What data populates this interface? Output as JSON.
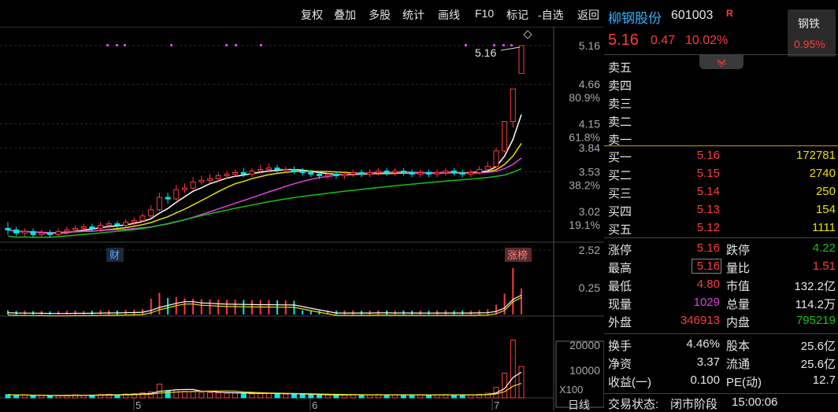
{
  "toolbar": {
    "items": [
      "复权",
      "叠加",
      "多股",
      "统计",
      "画线",
      "F10",
      "标记",
      "-自选",
      "返回"
    ]
  },
  "stock": {
    "name": "柳钢股份",
    "code": "601003",
    "flag": "R",
    "price": "5.16",
    "change": "0.47",
    "change_pct": "10.02%",
    "sector": "钢铁",
    "sector_pct": "0.95%"
  },
  "sell_labels": [
    "卖五",
    "卖四",
    "卖三",
    "卖二",
    "卖一"
  ],
  "buy": [
    {
      "label": "买一",
      "price": "5.16",
      "vol": "172781"
    },
    {
      "label": "买二",
      "price": "5.15",
      "vol": "2740"
    },
    {
      "label": "买三",
      "price": "5.14",
      "vol": "250"
    },
    {
      "label": "买四",
      "price": "5.13",
      "vol": "154"
    },
    {
      "label": "买五",
      "price": "5.12",
      "vol": "1111"
    }
  ],
  "stats1": [
    {
      "l1": "涨停",
      "v1": "5.16",
      "l2": "跌停",
      "v2": "4.22"
    },
    {
      "l1": "最高",
      "v1": "5.16",
      "l2": "量比",
      "v2": "1.51"
    },
    {
      "l1": "最低",
      "v1": "4.80",
      "l2": "市值",
      "v2": "132.2亿"
    },
    {
      "l1": "现量",
      "v1": "1029",
      "l2": "总量",
      "v2": "114.2万"
    },
    {
      "l1": "外盘",
      "v1": "346913",
      "l2": "内盘",
      "v2": "795219"
    }
  ],
  "stats2": [
    {
      "l1": "换手",
      "v1": "4.46%",
      "l2": "股本",
      "v2": "25.6亿"
    },
    {
      "l1": "净资",
      "v1": "3.37",
      "l2": "流通",
      "v2": "25.6亿"
    },
    {
      "l1": "收益(一)",
      "v1": "0.100",
      "l2": "PE(动)",
      "v2": "12.7"
    }
  ],
  "status": {
    "label": "交易状态:",
    "value": "闭市阶段",
    "time": "15:00:06"
  },
  "axis": {
    "price_ticks": [
      "5.16",
      "4.66",
      "4.15",
      "3.84",
      "3.53",
      "3.02",
      "2.52"
    ],
    "pct_ticks": [
      "80.9%",
      "61.8%",
      "38.2%",
      "19.1%"
    ],
    "macd_tick": "0.25",
    "vol_ticks": [
      "20000",
      "10000"
    ],
    "vol_unit": "X100",
    "x_ticks": [
      "5",
      "6",
      "7"
    ],
    "period": "日线"
  },
  "annotations": {
    "high_label": "5.16",
    "cai": "财",
    "zhangbang": "涨榜"
  },
  "chart_data": {
    "type": "candlestick",
    "ylim": [
      2.52,
      5.16
    ],
    "candles": [
      [
        2.8,
        2.78,
        2.88,
        2.72
      ],
      [
        2.78,
        2.74,
        2.82,
        2.7
      ],
      [
        2.74,
        2.76,
        2.8,
        2.7
      ],
      [
        2.76,
        2.72,
        2.8,
        2.68
      ],
      [
        2.72,
        2.74,
        2.78,
        2.68
      ],
      [
        2.74,
        2.72,
        2.78,
        2.68
      ],
      [
        2.72,
        2.76,
        2.8,
        2.7
      ],
      [
        2.76,
        2.78,
        2.82,
        2.72
      ],
      [
        2.78,
        2.8,
        2.84,
        2.74
      ],
      [
        2.8,
        2.82,
        2.86,
        2.76
      ],
      [
        2.82,
        2.8,
        2.86,
        2.76
      ],
      [
        2.8,
        2.84,
        2.88,
        2.78
      ],
      [
        2.84,
        2.86,
        2.9,
        2.8
      ],
      [
        2.86,
        2.84,
        2.9,
        2.8
      ],
      [
        2.84,
        2.88,
        2.92,
        2.82
      ],
      [
        2.88,
        2.9,
        2.94,
        2.84
      ],
      [
        2.9,
        2.96,
        3.0,
        2.88
      ],
      [
        2.96,
        3.04,
        3.1,
        2.94
      ],
      [
        3.04,
        3.2,
        3.26,
        3.02
      ],
      [
        3.2,
        3.18,
        3.26,
        3.12
      ],
      [
        3.18,
        3.3,
        3.36,
        3.16
      ],
      [
        3.3,
        3.32,
        3.38,
        3.26
      ],
      [
        3.32,
        3.4,
        3.46,
        3.3
      ],
      [
        3.4,
        3.42,
        3.48,
        3.36
      ],
      [
        3.42,
        3.44,
        3.5,
        3.38
      ],
      [
        3.44,
        3.48,
        3.52,
        3.4
      ],
      [
        3.48,
        3.5,
        3.54,
        3.44
      ],
      [
        3.5,
        3.52,
        3.56,
        3.46
      ],
      [
        3.52,
        3.5,
        3.58,
        3.46
      ],
      [
        3.5,
        3.54,
        3.58,
        3.46
      ],
      [
        3.54,
        3.56,
        3.62,
        3.5
      ],
      [
        3.56,
        3.58,
        3.64,
        3.52
      ],
      [
        3.58,
        3.56,
        3.62,
        3.52
      ],
      [
        3.56,
        3.56,
        3.6,
        3.52
      ],
      [
        3.56,
        3.54,
        3.6,
        3.5
      ],
      [
        3.54,
        3.52,
        3.58,
        3.48
      ],
      [
        3.52,
        3.5,
        3.56,
        3.46
      ],
      [
        3.5,
        3.48,
        3.54,
        3.44
      ],
      [
        3.48,
        3.5,
        3.54,
        3.44
      ],
      [
        3.5,
        3.48,
        3.54,
        3.44
      ],
      [
        3.48,
        3.5,
        3.54,
        3.44
      ],
      [
        3.5,
        3.52,
        3.56,
        3.46
      ],
      [
        3.52,
        3.5,
        3.56,
        3.46
      ],
      [
        3.5,
        3.52,
        3.56,
        3.46
      ],
      [
        3.52,
        3.54,
        3.58,
        3.48
      ],
      [
        3.54,
        3.52,
        3.58,
        3.48
      ],
      [
        3.52,
        3.54,
        3.58,
        3.48
      ],
      [
        3.54,
        3.52,
        3.58,
        3.48
      ],
      [
        3.52,
        3.5,
        3.56,
        3.46
      ],
      [
        3.5,
        3.52,
        3.56,
        3.46
      ],
      [
        3.52,
        3.5,
        3.56,
        3.46
      ],
      [
        3.5,
        3.52,
        3.56,
        3.46
      ],
      [
        3.52,
        3.54,
        3.58,
        3.48
      ],
      [
        3.54,
        3.52,
        3.58,
        3.48
      ],
      [
        3.52,
        3.5,
        3.56,
        3.46
      ],
      [
        3.5,
        3.52,
        3.56,
        3.46
      ],
      [
        3.52,
        3.56,
        3.6,
        3.5
      ],
      [
        3.56,
        3.6,
        3.66,
        3.54
      ],
      [
        3.6,
        3.8,
        3.84,
        3.58
      ],
      [
        3.8,
        4.18,
        4.18,
        3.78
      ],
      [
        4.18,
        4.6,
        4.6,
        4.1
      ],
      [
        4.8,
        5.16,
        5.16,
        4.8
      ]
    ],
    "volume_max": 22000,
    "volumes": [
      1200,
      900,
      1000,
      800,
      900,
      700,
      800,
      1000,
      1100,
      900,
      1000,
      1200,
      1300,
      1100,
      1400,
      1500,
      1800,
      2200,
      5000,
      2600,
      3000,
      2400,
      2200,
      2000,
      1900,
      1800,
      1700,
      1800,
      1600,
      1500,
      1600,
      1700,
      1500,
      1400,
      1300,
      1200,
      1100,
      1000,
      1100,
      1000,
      1100,
      1200,
      1000,
      1100,
      1200,
      1100,
      1000,
      1100,
      1000,
      1100,
      1000,
      1100,
      1200,
      1000,
      1100,
      1000,
      1300,
      1700,
      3800,
      9000,
      21000,
      11400
    ]
  }
}
